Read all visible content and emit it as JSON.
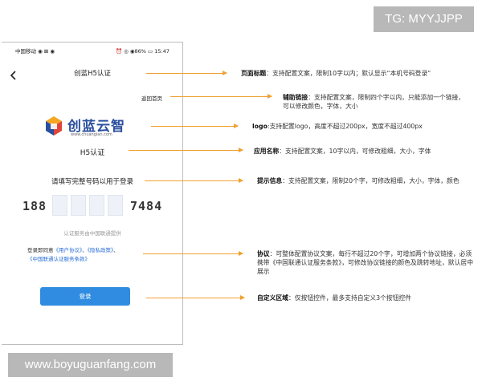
{
  "watermarks": {
    "tg": "TG: MYYJJPP",
    "site": "www.boyuguanfang.com"
  },
  "status_bar": {
    "carrier": "中国移动 ◉ ⊠ ◉",
    "right": "⏰ ◎ ◉86% ▭ 15:47"
  },
  "screen": {
    "title": "创蓝H5认证",
    "return_link": "返回首页",
    "logo_brand": "创蓝云智",
    "logo_url": "www.chuanglan.com",
    "app_name": "H5认证",
    "prompt": "请填写完整号码以用于登录",
    "phone_prefix": "188",
    "phone_suffix": "7484",
    "service_note": "认证服务由中国联通提供",
    "agreement": {
      "prefix": "登录即同意",
      "link1": "《用户协议》",
      "sep": "、",
      "link2": "《隐私政策》",
      "sep2": "、",
      "link3": "《中国联通认证服务条款》"
    },
    "login_button": "登录"
  },
  "annotations": [
    {
      "label": "页面标题",
      "text": "：支持配置文案，限制10字以内；默认显示“本机号码登录”"
    },
    {
      "label": "辅助链接",
      "text": "：支持配置文案，限制四个字以内，只能添加一个链接，可以修改颜色，字体，大小"
    },
    {
      "label": "logo",
      "text": ":支持配置logo，高度不超过200px，宽度不超过400px"
    },
    {
      "label": "应用名称",
      "text": "：支持配置文案，10字以内，可修改粗细，大小，字体"
    },
    {
      "label": "提示信息",
      "text": "：支持配置文案，限制20个字，可修改粗细，大小，字体，颜色"
    },
    {
      "label": "协议",
      "text": "：可整体配置协议文案，每行不超过20个字，可增加两个协议链接，必须携带《中国联通认证服务条款》，可修改协议链接的颜色及跳转地址，默认居中展示"
    },
    {
      "label": "自定义区域",
      "text": "：仅按钮控件，最多支持自定义3个按钮控件"
    }
  ],
  "colors": {
    "accent_arrow": "#f0a030",
    "button_blue": "#2f8ce0",
    "link_blue": "#2a6fd6",
    "brand_blue": "#2a4f9f"
  }
}
